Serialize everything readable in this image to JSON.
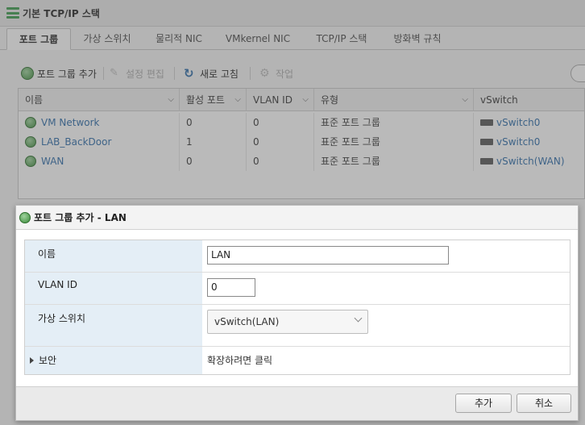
{
  "window": {
    "title": "기본 TCP/IP 스택"
  },
  "tabs": [
    {
      "label": "포트 그룹"
    },
    {
      "label": "가상 스위치"
    },
    {
      "label": "물리적 NIC"
    },
    {
      "label": "VMkernel NIC"
    },
    {
      "label": "TCP/IP 스택"
    },
    {
      "label": "방화벽 규칙"
    }
  ],
  "toolbar": {
    "add": "포트 그룹 추가",
    "edit": "설정 편집",
    "refresh": "새로 고침",
    "actions": "작업"
  },
  "grid": {
    "columns": [
      "이름",
      "활성 포트",
      "VLAN ID",
      "유형",
      "vSwitch"
    ],
    "rows": [
      {
        "name": "VM Network",
        "ports": "0",
        "vlan": "0",
        "type": "표준 포트 그룹",
        "vswitch": "vSwitch0"
      },
      {
        "name": "LAB_BackDoor",
        "ports": "1",
        "vlan": "0",
        "type": "표준 포트 그룹",
        "vswitch": "vSwitch0"
      },
      {
        "name": "WAN",
        "ports": "0",
        "vlan": "0",
        "type": "표준 포트 그룹",
        "vswitch": "vSwitch(WAN)"
      }
    ]
  },
  "dialog": {
    "title": "포트 그룹 추가 - LAN",
    "fields": {
      "name_label": "이름",
      "name_value": "LAN",
      "vlan_label": "VLAN ID",
      "vlan_value": "0",
      "vswitch_label": "가상 스위치",
      "vswitch_value": "vSwitch(LAN)",
      "security_label": "보안",
      "security_hint": "확장하려면 클릭"
    },
    "buttons": {
      "ok": "추가",
      "cancel": "취소"
    }
  },
  "colors": {
    "accent_link": "#2a6aa8",
    "label_bg": "#e4eef6",
    "net_icon": "#3a8a3a"
  }
}
